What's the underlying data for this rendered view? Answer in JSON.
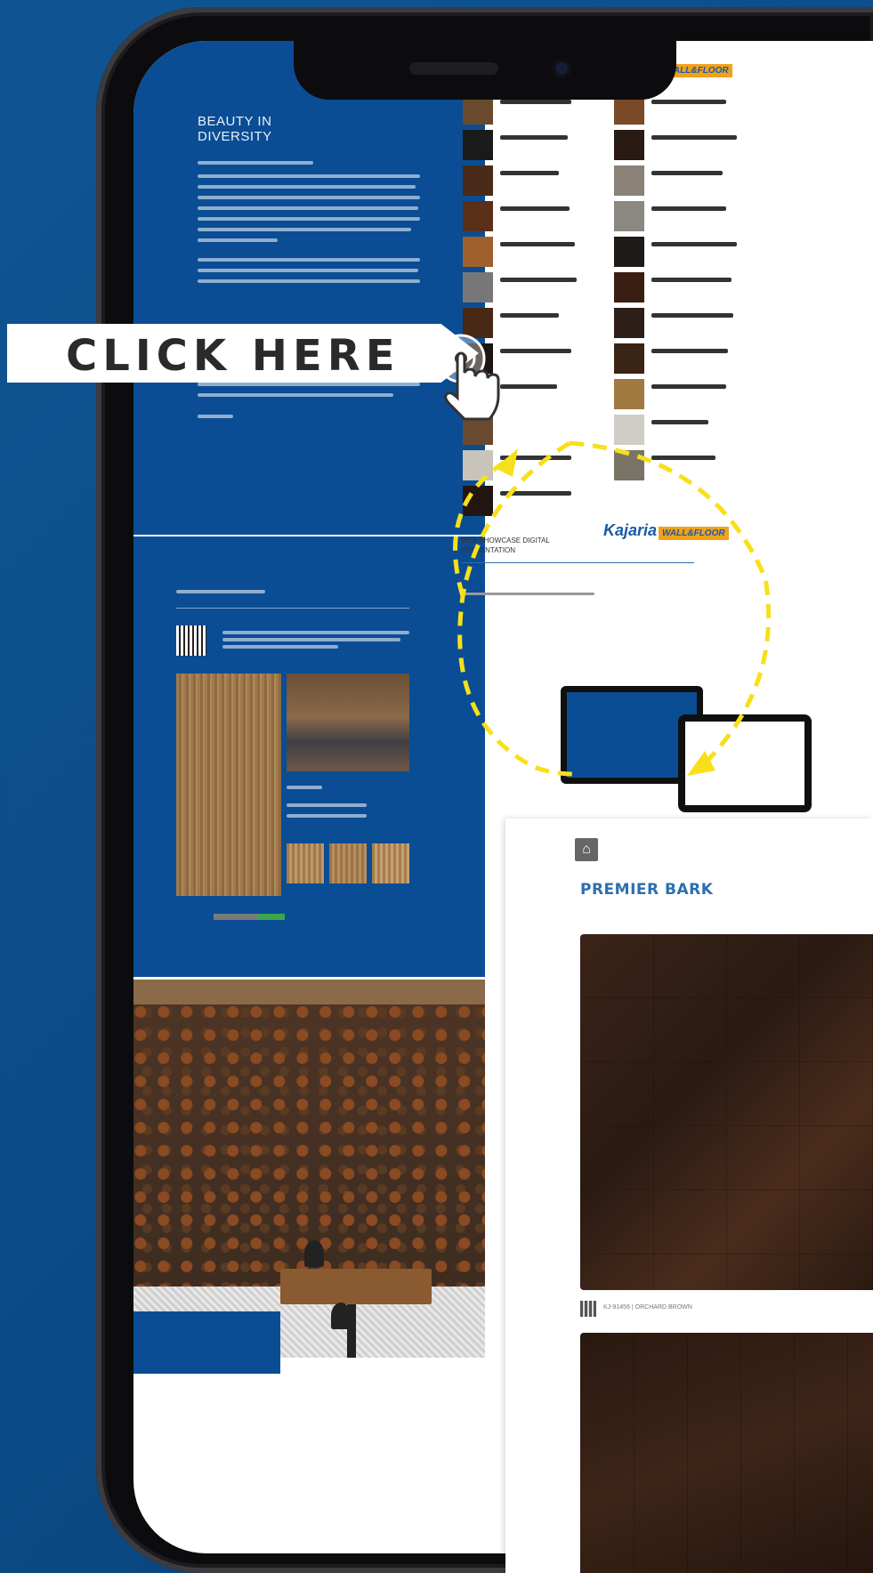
{
  "brand": {
    "logo_text": "Kajaria",
    "logo_badge": "WALL&FLOOR"
  },
  "cta": {
    "click_label": "CLICK HERE"
  },
  "brochure": {
    "left_heading": "BEAUTY IN DIVERSITY",
    "section2_heading": "WEB SHOWCASE DIGITAL PRESENTATION"
  },
  "popup": {
    "title": "PREMIER BARK",
    "tile_code": "KJ-91456 | ORCHARD BROWN"
  },
  "colors": {
    "background": "#0b4b88",
    "brochure_blue": "#0a4d94",
    "popup_title": "#2c6fae",
    "arrow": "#f7e01a"
  },
  "icons": {
    "home": "home-icon",
    "hand": "hand-pointer-icon"
  }
}
